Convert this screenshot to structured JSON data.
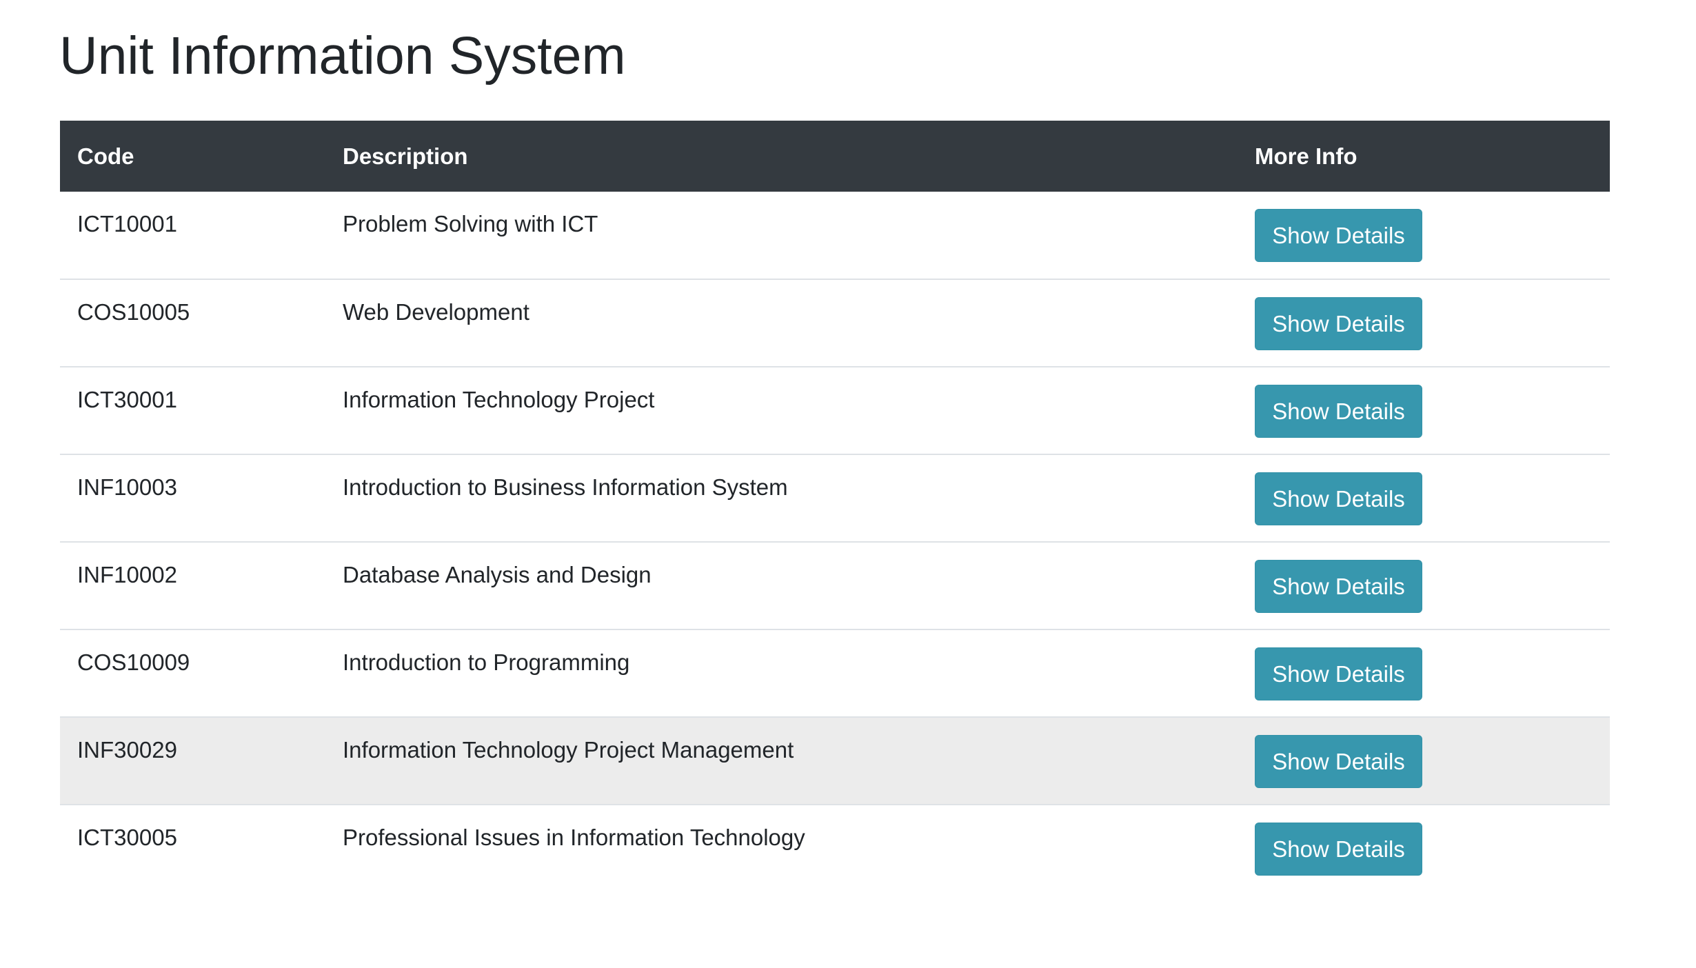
{
  "page": {
    "title": "Unit Information System"
  },
  "table": {
    "headers": {
      "code": "Code",
      "description": "Description",
      "more_info": "More Info"
    },
    "rows": [
      {
        "code": "ICT10001",
        "description": "Problem Solving with ICT",
        "button_label": "Show Details"
      },
      {
        "code": "COS10005",
        "description": "Web Development",
        "button_label": "Show Details"
      },
      {
        "code": "ICT30001",
        "description": "Information Technology Project",
        "button_label": "Show Details"
      },
      {
        "code": "INF10003",
        "description": "Introduction to Business Information System",
        "button_label": "Show Details"
      },
      {
        "code": "INF10002",
        "description": "Database Analysis and Design",
        "button_label": "Show Details"
      },
      {
        "code": "COS10009",
        "description": "Introduction to Programming",
        "button_label": "Show Details"
      },
      {
        "code": "INF30029",
        "description": "Information Technology Project Management",
        "button_label": "Show Details"
      },
      {
        "code": "ICT30005",
        "description": "Professional Issues in Information Technology",
        "button_label": "Show Details"
      }
    ],
    "hovered_row_index": 6
  },
  "colors": {
    "header_background": "#343a40",
    "button_background": "#3797ae",
    "hover_row_background": "#ececec",
    "text": "#212529"
  }
}
